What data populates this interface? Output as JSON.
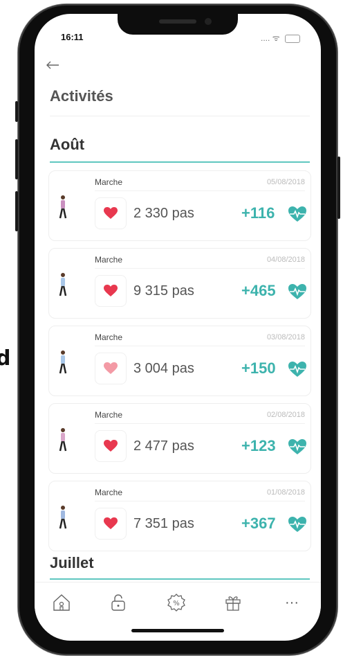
{
  "stray_letter": "d",
  "status_bar": {
    "time": "16:11",
    "signal_dots": "....",
    "wifi": "ᯤ"
  },
  "header": {
    "back_icon": "back-arrow-icon",
    "title": "Activités"
  },
  "sections": [
    {
      "month": "Août",
      "activities": [
        {
          "type": "Marche",
          "date": "05/08/2018",
          "steps": "2 330 pas",
          "points": "+116"
        },
        {
          "type": "Marche",
          "date": "04/08/2018",
          "steps": "9 315 pas",
          "points": "+465"
        },
        {
          "type": "Marche",
          "date": "03/08/2018",
          "steps": "3 004 pas",
          "points": "+150"
        },
        {
          "type": "Marche",
          "date": "02/08/2018",
          "steps": "2 477 pas",
          "points": "+123"
        },
        {
          "type": "Marche",
          "date": "01/08/2018",
          "steps": "7 351 pas",
          "points": "+367"
        }
      ]
    },
    {
      "month": "Juillet"
    }
  ],
  "tabbar": {
    "items": [
      {
        "icon": "home-icon"
      },
      {
        "icon": "unlock-icon"
      },
      {
        "icon": "discount-badge-icon"
      },
      {
        "icon": "gift-icon"
      },
      {
        "icon": "more-icon",
        "text": "···"
      }
    ]
  },
  "colors": {
    "accent": "#3db3ad",
    "heart": "#e8384f",
    "heart_light": "#f39aa5"
  }
}
